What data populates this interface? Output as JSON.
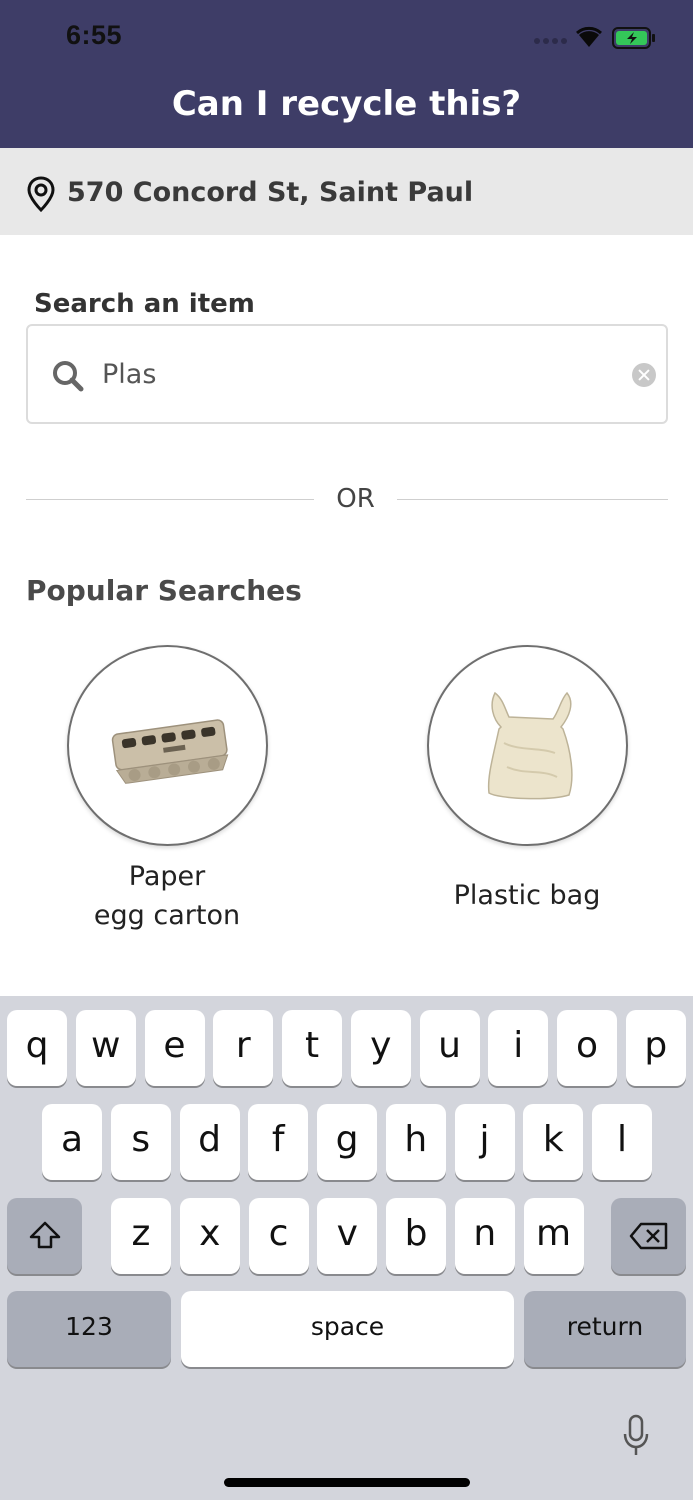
{
  "status_bar": {
    "time": "6:55"
  },
  "header": {
    "title": "Can I recycle this?"
  },
  "location": {
    "address": "570 Concord St, Saint Paul"
  },
  "search": {
    "label": "Search an item",
    "value": "Plas"
  },
  "divider": {
    "text": "OR"
  },
  "popular": {
    "title": "Popular Searches",
    "items": [
      {
        "label_line1": "Paper",
        "label_line2": "egg carton",
        "icon": "egg-carton-image"
      },
      {
        "label": "Plastic bag",
        "icon": "plastic-bag-image"
      }
    ]
  },
  "keyboard": {
    "row1": [
      "q",
      "w",
      "e",
      "r",
      "t",
      "y",
      "u",
      "i",
      "o",
      "p"
    ],
    "row2": [
      "a",
      "s",
      "d",
      "f",
      "g",
      "h",
      "j",
      "k",
      "l"
    ],
    "row3": [
      "z",
      "x",
      "c",
      "v",
      "b",
      "n",
      "m"
    ],
    "numbers_label": "123",
    "space_label": "space",
    "return_label": "return"
  },
  "colors": {
    "header_bg": "#3e3d67",
    "location_bg": "#e8e8e8",
    "keyboard_bg": "#d3d5dc",
    "battery_green": "#34c759"
  }
}
